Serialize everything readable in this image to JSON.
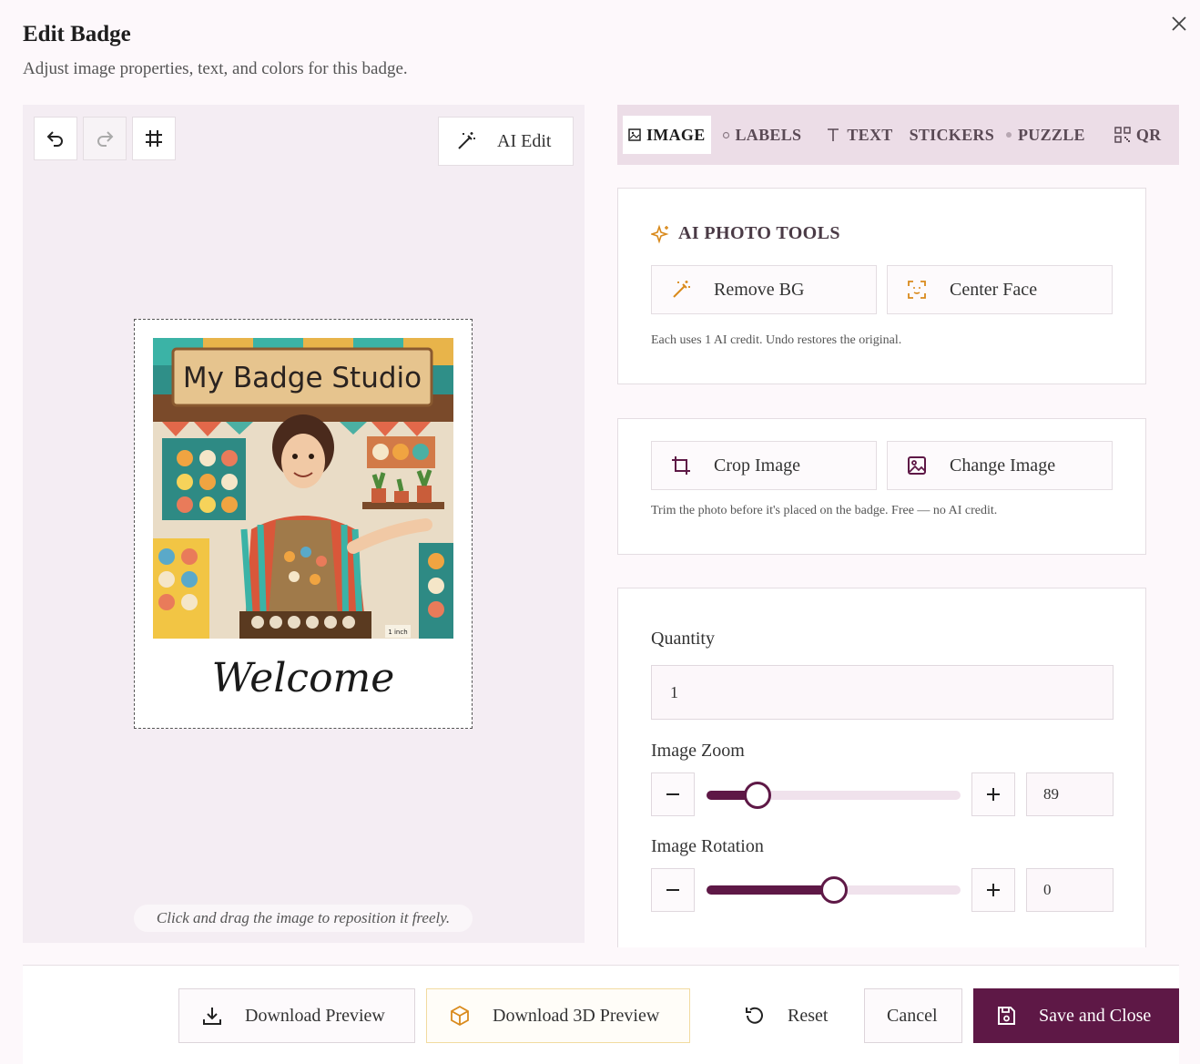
{
  "dialog": {
    "title": "Edit Badge",
    "subtitle": "Adjust image properties, text, and colors for this badge."
  },
  "toolbar": {
    "undo_icon": "undo-icon",
    "redo_icon": "redo-icon",
    "grid_icon": "grid-icon",
    "ai_edit_label": "AI Edit"
  },
  "badge": {
    "photo_sign": "My Badge Studio",
    "photo_ruler_label": "1 inch",
    "text": "Welcome",
    "hint": "Click and drag the image to reposition it freely."
  },
  "tabs": [
    {
      "label": "IMAGE",
      "icon": "image-icon",
      "active": true
    },
    {
      "label": "LABELS",
      "icon": "tag-icon",
      "active": false
    },
    {
      "label": "TEXT",
      "icon": "text-icon",
      "active": false
    },
    {
      "label": "STICKERS",
      "icon": "",
      "active": false
    },
    {
      "label": "PUZZLE",
      "icon": "puzzle-icon",
      "active": false
    },
    {
      "label": "QR",
      "icon": "qr-icon",
      "active": false
    }
  ],
  "ai_tools": {
    "title": "AI PHOTO TOOLS",
    "remove_bg_label": "Remove BG",
    "center_face_label": "Center Face",
    "note": "Each uses 1 AI credit. Undo restores the original."
  },
  "image_tools": {
    "crop_label": "Crop Image",
    "change_label": "Change Image",
    "note": "Trim the photo before it's placed on the badge. Free — no AI credit."
  },
  "settings": {
    "quantity_label": "Quantity",
    "quantity_value": "1",
    "zoom_label": "Image Zoom",
    "zoom_value": "89",
    "zoom_fraction": 0.2,
    "rotation_label": "Image Rotation",
    "rotation_value": "0",
    "rotation_fraction": 0.5
  },
  "footer": {
    "download_preview_label": "Download Preview",
    "download_3d_label": "Download 3D Preview",
    "reset_label": "Reset",
    "cancel_label": "Cancel",
    "save_label": "Save and Close"
  },
  "colors": {
    "accent": "#5e1846",
    "tabs_bg": "#ecdde7",
    "canvas_bg": "#f4edf3",
    "ai_icon": "#d98a1c"
  }
}
